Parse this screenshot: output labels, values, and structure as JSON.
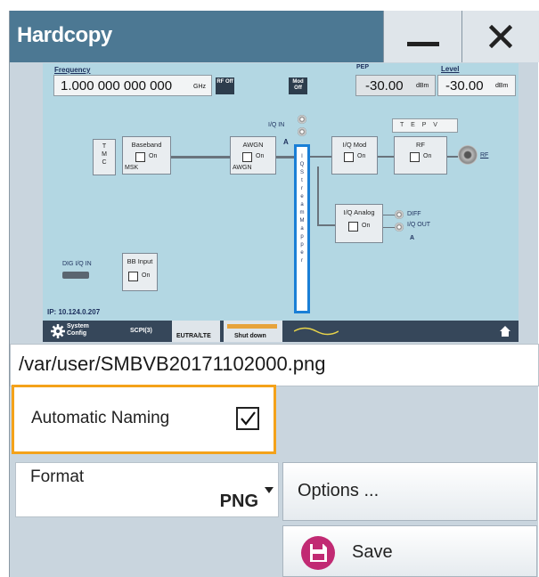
{
  "window": {
    "title": "Hardcopy"
  },
  "preview": {
    "frequency_label": "Frequency",
    "frequency_value": "1.000 000 000 000",
    "frequency_unit": "GHz",
    "rf_state": "RF Off",
    "mod_state": "Mod Off",
    "pep_label": "PEP",
    "pep_value": "-30.00",
    "pep_unit": "dBm",
    "level_label": "Level",
    "level_value": "-30.00",
    "level_unit": "dBm",
    "tmc": "T M C",
    "baseband": "Baseband",
    "baseband_on": "On",
    "msk": "MSK",
    "awgn": "AWGN",
    "awgn_on": "On",
    "awgn_sub": "AWGN",
    "iq_in": "I/Q IN",
    "path_a": "A",
    "iq_stream_mapper": "I Q S t r e a m M a p p e r",
    "iq_mod": "I/Q Mod",
    "iq_mod_on": "On",
    "tepv": "T E P V",
    "rf": "RF",
    "rf_on": "On",
    "rf_port": "RF",
    "iq_analog": "I/Q Analog",
    "iq_analog_on": "On",
    "diff": "DIFF",
    "iq_out": "I/Q OUT",
    "out_a": "A",
    "dig_iq_in": "DIG I/Q IN",
    "bb_input": "BB Input",
    "bb_input_on": "On",
    "ip": "IP: 10.124.0.207",
    "tabs": {
      "system_config": "System Config",
      "scpi": "SCPI(3)",
      "eutra": "EUTRA/LTE",
      "shutdown": "Shut down"
    }
  },
  "file_path": "/var/user/SMBVB20171102000.png",
  "automatic_naming": {
    "label": "Automatic Naming",
    "checked": true
  },
  "format": {
    "label": "Format",
    "value": "PNG"
  },
  "buttons": {
    "options": "Options ...",
    "save": "Save"
  },
  "colors": {
    "title_bar": "#4c7893",
    "focus_border": "#f4a21a",
    "save_icon": "#c12a73"
  }
}
